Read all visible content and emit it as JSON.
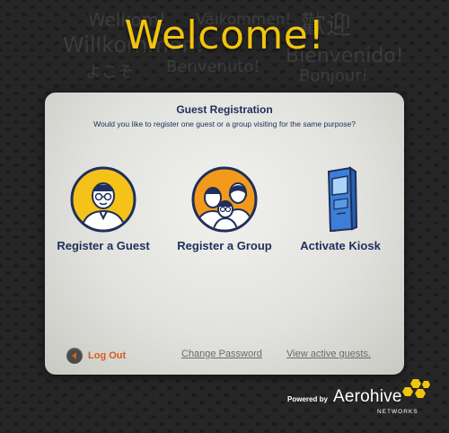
{
  "background_words": [
    "Welkom!",
    "Välkommen!",
    "歡迎",
    "Willkommen!",
    "Bienvenido!",
    "Bonjour!",
    "よこそ",
    "Benvenuto!"
  ],
  "header": {
    "title": "Welcome!"
  },
  "panel": {
    "title": "Guest Registration",
    "subtitle": "Would you like to register one guest or a group visiting for the same purpose?",
    "options": [
      {
        "label": "Register a Guest",
        "icon": "single-guest-icon"
      },
      {
        "label": "Register a Group",
        "icon": "group-guests-icon"
      },
      {
        "label": "Activate Kiosk",
        "icon": "kiosk-icon"
      }
    ],
    "logout_label": "Log Out",
    "links": {
      "change_password": "Change Password",
      "view_active_guests": "View active guests."
    }
  },
  "footer": {
    "powered_by": "Powered by",
    "brand": "Aerohive",
    "networks": "NETWORKS"
  },
  "colors": {
    "accent": "#f2c40f",
    "navy": "#1f2f5c",
    "logout": "#d35e1e",
    "link": "#6a6a6a"
  }
}
